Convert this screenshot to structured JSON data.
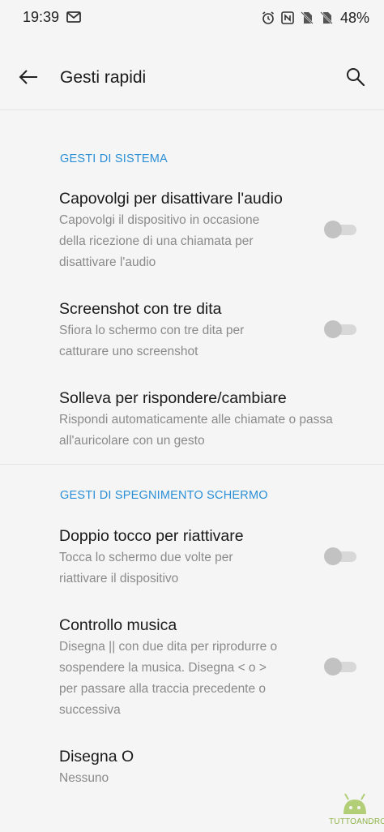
{
  "status_bar": {
    "time": "19:39",
    "battery": "48%",
    "icons": [
      "gmail-icon",
      "alarm-icon",
      "nfc-icon",
      "sim-off-icon",
      "sim-off-icon",
      "battery-icon"
    ]
  },
  "app_bar": {
    "title": "Gesti rapidi",
    "back_icon": "arrow-left-icon",
    "search_icon": "search-icon"
  },
  "sections": {
    "system": {
      "header": "GESTI DI SISTEMA",
      "items": [
        {
          "title": "Capovolgi per disattivare l'audio",
          "summary_lines": [
            "Capovolgi il dispositivo in occasione",
            "della ricezione di una chiamata per",
            "disattivare l'audio"
          ],
          "toggle": "off"
        },
        {
          "title": "Screenshot con tre dita",
          "summary_lines": [
            "Sfiora lo schermo con tre dita per",
            "catturare uno screenshot"
          ],
          "toggle": "off"
        },
        {
          "title": "Solleva per rispondere/cambiare",
          "summary_lines": [
            "Rispondi automaticamente alle chiamate o passa",
            "all'auricolare con un gesto"
          ]
        }
      ]
    },
    "screen_off": {
      "header": "GESTI DI SPEGNIMENTO SCHERMO",
      "items": [
        {
          "title": "Doppio tocco per riattivare",
          "summary_lines": [
            "Tocca lo schermo due volte per",
            "riattivare il dispositivo"
          ],
          "toggle": "off"
        },
        {
          "title": "Controllo musica",
          "summary_lines": [
            "Disegna || con due dita per riprodurre o",
            "sospendere la musica. Disegna < o >",
            "per passare alla traccia precedente o",
            "successiva"
          ],
          "toggle": "off"
        },
        {
          "title": "Disegna O",
          "summary_lines": [
            "Nessuno"
          ]
        }
      ]
    }
  },
  "watermark": {
    "text": "TUTTOANDROID",
    "color": "#8fb34a"
  },
  "colors": {
    "accent": "#2a8fd6",
    "background": "#f5f5f5",
    "toggle_off_thumb": "#c2c2c2",
    "toggle_off_track": "#d8d8d8"
  }
}
